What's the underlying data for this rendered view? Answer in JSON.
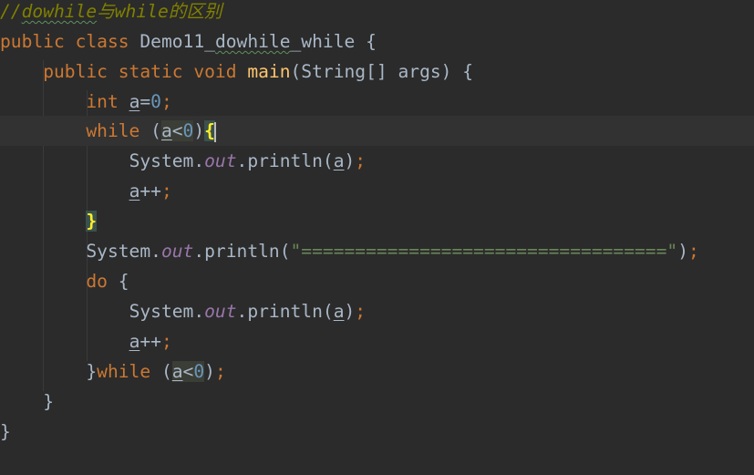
{
  "editor": {
    "lines": {
      "l1": {
        "comment_prefix": "//",
        "comment_word": "dowhile",
        "comment_rest": "与while的区别"
      },
      "l2": {
        "kw_public": "public",
        "kw_class": "class",
        "class_name_a": "Demo11_",
        "class_name_b": "dowhile",
        "class_name_c": "_while",
        "brace": "{"
      },
      "l3": {
        "kw_public": "public",
        "kw_static": "static",
        "kw_void": "void",
        "method": "main",
        "params": "(String[] args)",
        "brace": "{"
      },
      "l4": {
        "kw_int": "int",
        "var": "a",
        "eq": "=",
        "num": "0",
        "semi": ";"
      },
      "l5": {
        "kw_while": "while",
        "open": "(",
        "var": "a",
        "op": "<",
        "num": "0",
        "close": ")",
        "brace": "{"
      },
      "l6": {
        "cls": "System.",
        "field": "out",
        "call": ".println(",
        "var": "a",
        "close": ")",
        "semi": ";"
      },
      "l7": {
        "var": "a",
        "op": "++",
        "semi": ";"
      },
      "l8": {
        "brace": "}"
      },
      "l9": {
        "cls": "System.",
        "field": "out",
        "call": ".println(",
        "str": "\"==================================\"",
        "close": ")",
        "semi": ";"
      },
      "l10": {
        "kw_do": "do",
        "brace": "{"
      },
      "l11": {
        "cls": "System.",
        "field": "out",
        "call": ".println(",
        "var": "a",
        "close": ")",
        "semi": ";"
      },
      "l12": {
        "var": "a",
        "op": "++",
        "semi": ";"
      },
      "l13": {
        "brace": "}",
        "kw_while": "while",
        "open": "(",
        "var": "a",
        "op": "<",
        "num": "0",
        "close": ")",
        "semi": ";"
      },
      "l14": {
        "brace": "}"
      },
      "l15": {
        "brace": "}"
      }
    }
  }
}
